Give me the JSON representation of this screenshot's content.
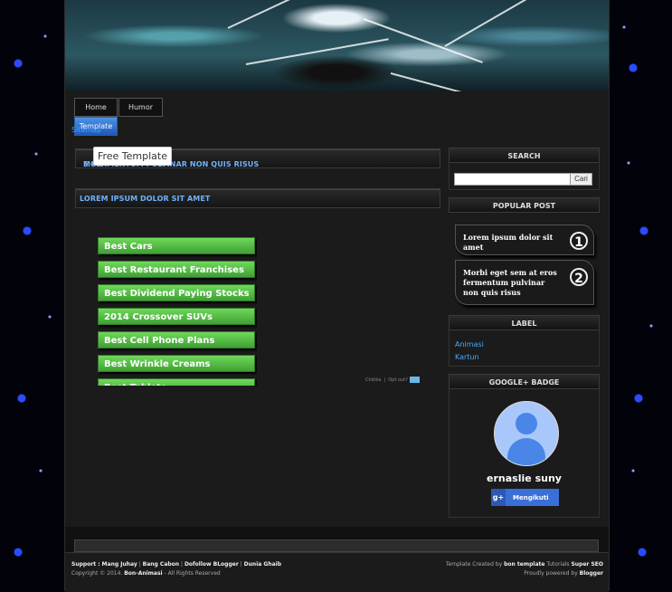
{
  "nav": {
    "tabs": [
      {
        "label": "Home"
      },
      {
        "label": "Humor"
      },
      {
        "label": "Template"
      }
    ],
    "sitemap_label": "Sitemap",
    "tooltip": "Free Template"
  },
  "posts": [
    {
      "title_visible_start": "MOR",
      "title_visible_end": "S FERMENTUM PULVINAR NON QUIS RISUS"
    },
    {
      "title": "LOREM IPSUM DOLOR SIT AMET"
    }
  ],
  "ads": {
    "links": [
      "Best Cars",
      "Best Restaurant Franchises",
      "Best Dividend Paying Stocks",
      "2014 Crossover SUVs",
      "Best Cell Phone Plans",
      "Best Wrinkle Creams",
      "Best Tablets"
    ],
    "choices_label": "Chitika",
    "separator": "|",
    "optout_label": "Opt out?"
  },
  "sidebar": {
    "search": {
      "heading": "SEARCH",
      "button_label": "Cari",
      "value": ""
    },
    "popular": {
      "heading": "POPULAR POST",
      "items": [
        {
          "title": "Lorem ipsum dolor sit amet",
          "rank": "1"
        },
        {
          "title": "Morbi eget sem at eros fermentum pulvinar non quis risus",
          "rank": "2"
        }
      ]
    },
    "label": {
      "heading": "LABEL",
      "items": [
        "Animasi",
        "Kartun"
      ]
    },
    "gplus": {
      "heading": "GOOGLE+ BADGE",
      "name": "ernaslie suny",
      "follow_label": "Mengikuti",
      "g_icon": "g+"
    }
  },
  "footer": {
    "support_label": "Support :",
    "support_links": [
      "Mang Juhay",
      "Bang Cabon",
      "Dofollow BLogger",
      "Dunia Ghaib"
    ],
    "sep": "|",
    "copyright_prefix": "Copyright © 2014.",
    "copyright_site": "Bon-Animasi",
    "copyright_suffix": "- All Rights Reserved",
    "template_prefix": "Template Created by",
    "template_author": "bon template",
    "tutorials_label": "Tutorials",
    "tutorials_site": "Super SEO",
    "powered_prefix": "Proudly powered by",
    "powered_by": "Blogger"
  },
  "colors": {
    "accent_link": "#49a9ff",
    "ad_green": "#4fb63f",
    "follow_blue": "#3b6fd8"
  }
}
